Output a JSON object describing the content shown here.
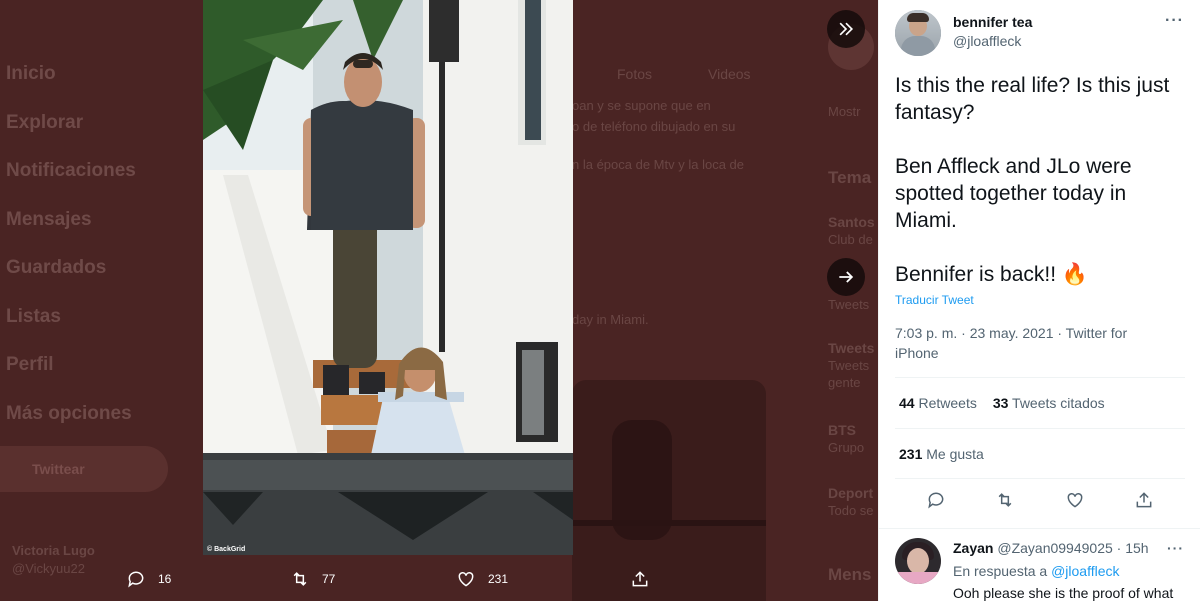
{
  "background": {
    "nav": [
      "Inicio",
      "Explorar",
      "Notificaciones",
      "Mensajes",
      "Guardados",
      "Listas",
      "Perfil",
      "Más opciones"
    ],
    "tweet_button": "Twittear",
    "user_name": "Victoria Lugo",
    "user_handle": "@Vickyuu22",
    "tabs": [
      "Fotos",
      "Videos"
    ],
    "texts": [
      "oan y se supone que en",
      "o de teléfono dibujado en su",
      "n la época de Mtv y la loca de",
      "day in Miami."
    ],
    "right": [
      "Mostr",
      "Tema",
      "Santos",
      "Club de",
      "Tweets",
      "Tweets",
      "Tweets",
      "gente",
      "BTS",
      "Grupo",
      "Deport",
      "Todo se",
      "Mens"
    ]
  },
  "media": {
    "credit": "© BackGrid",
    "actions": {
      "replies": "16",
      "retweets": "77",
      "likes": "231"
    }
  },
  "tweet": {
    "author_name": "bennifer tea",
    "author_handle": "@jloaffleck",
    "text": "Is this the real life? Is this just fantasy?\n\nBen Affleck and JLo were spotted together today in Miami.\n\nBennifer is back!! 🔥",
    "translate": "Traducir Tweet",
    "timestamp": "7:03 p. m. · 23 may. 2021 · Twitter for iPhone",
    "retweets_count": "44",
    "retweets_label": "Retweets",
    "quotes_count": "33",
    "quotes_label": "Tweets citados",
    "likes_count": "231",
    "likes_label": "Me gusta"
  },
  "reply": {
    "name": "Zayan",
    "handle": "@Zayan09949025",
    "time": "· 15h",
    "in_reply_prefix": "En respuesta a",
    "in_reply_handle": "@jloaffleck",
    "text": "Ooh please she is the proof of what"
  },
  "colors": {
    "accent": "#1d9bf0",
    "overlay": "#4a2423"
  },
  "icons": [
    "collapse-panel-icon",
    "next-arrow-icon",
    "reply-icon",
    "retweet-icon",
    "like-icon",
    "share-icon",
    "more-icon"
  ]
}
